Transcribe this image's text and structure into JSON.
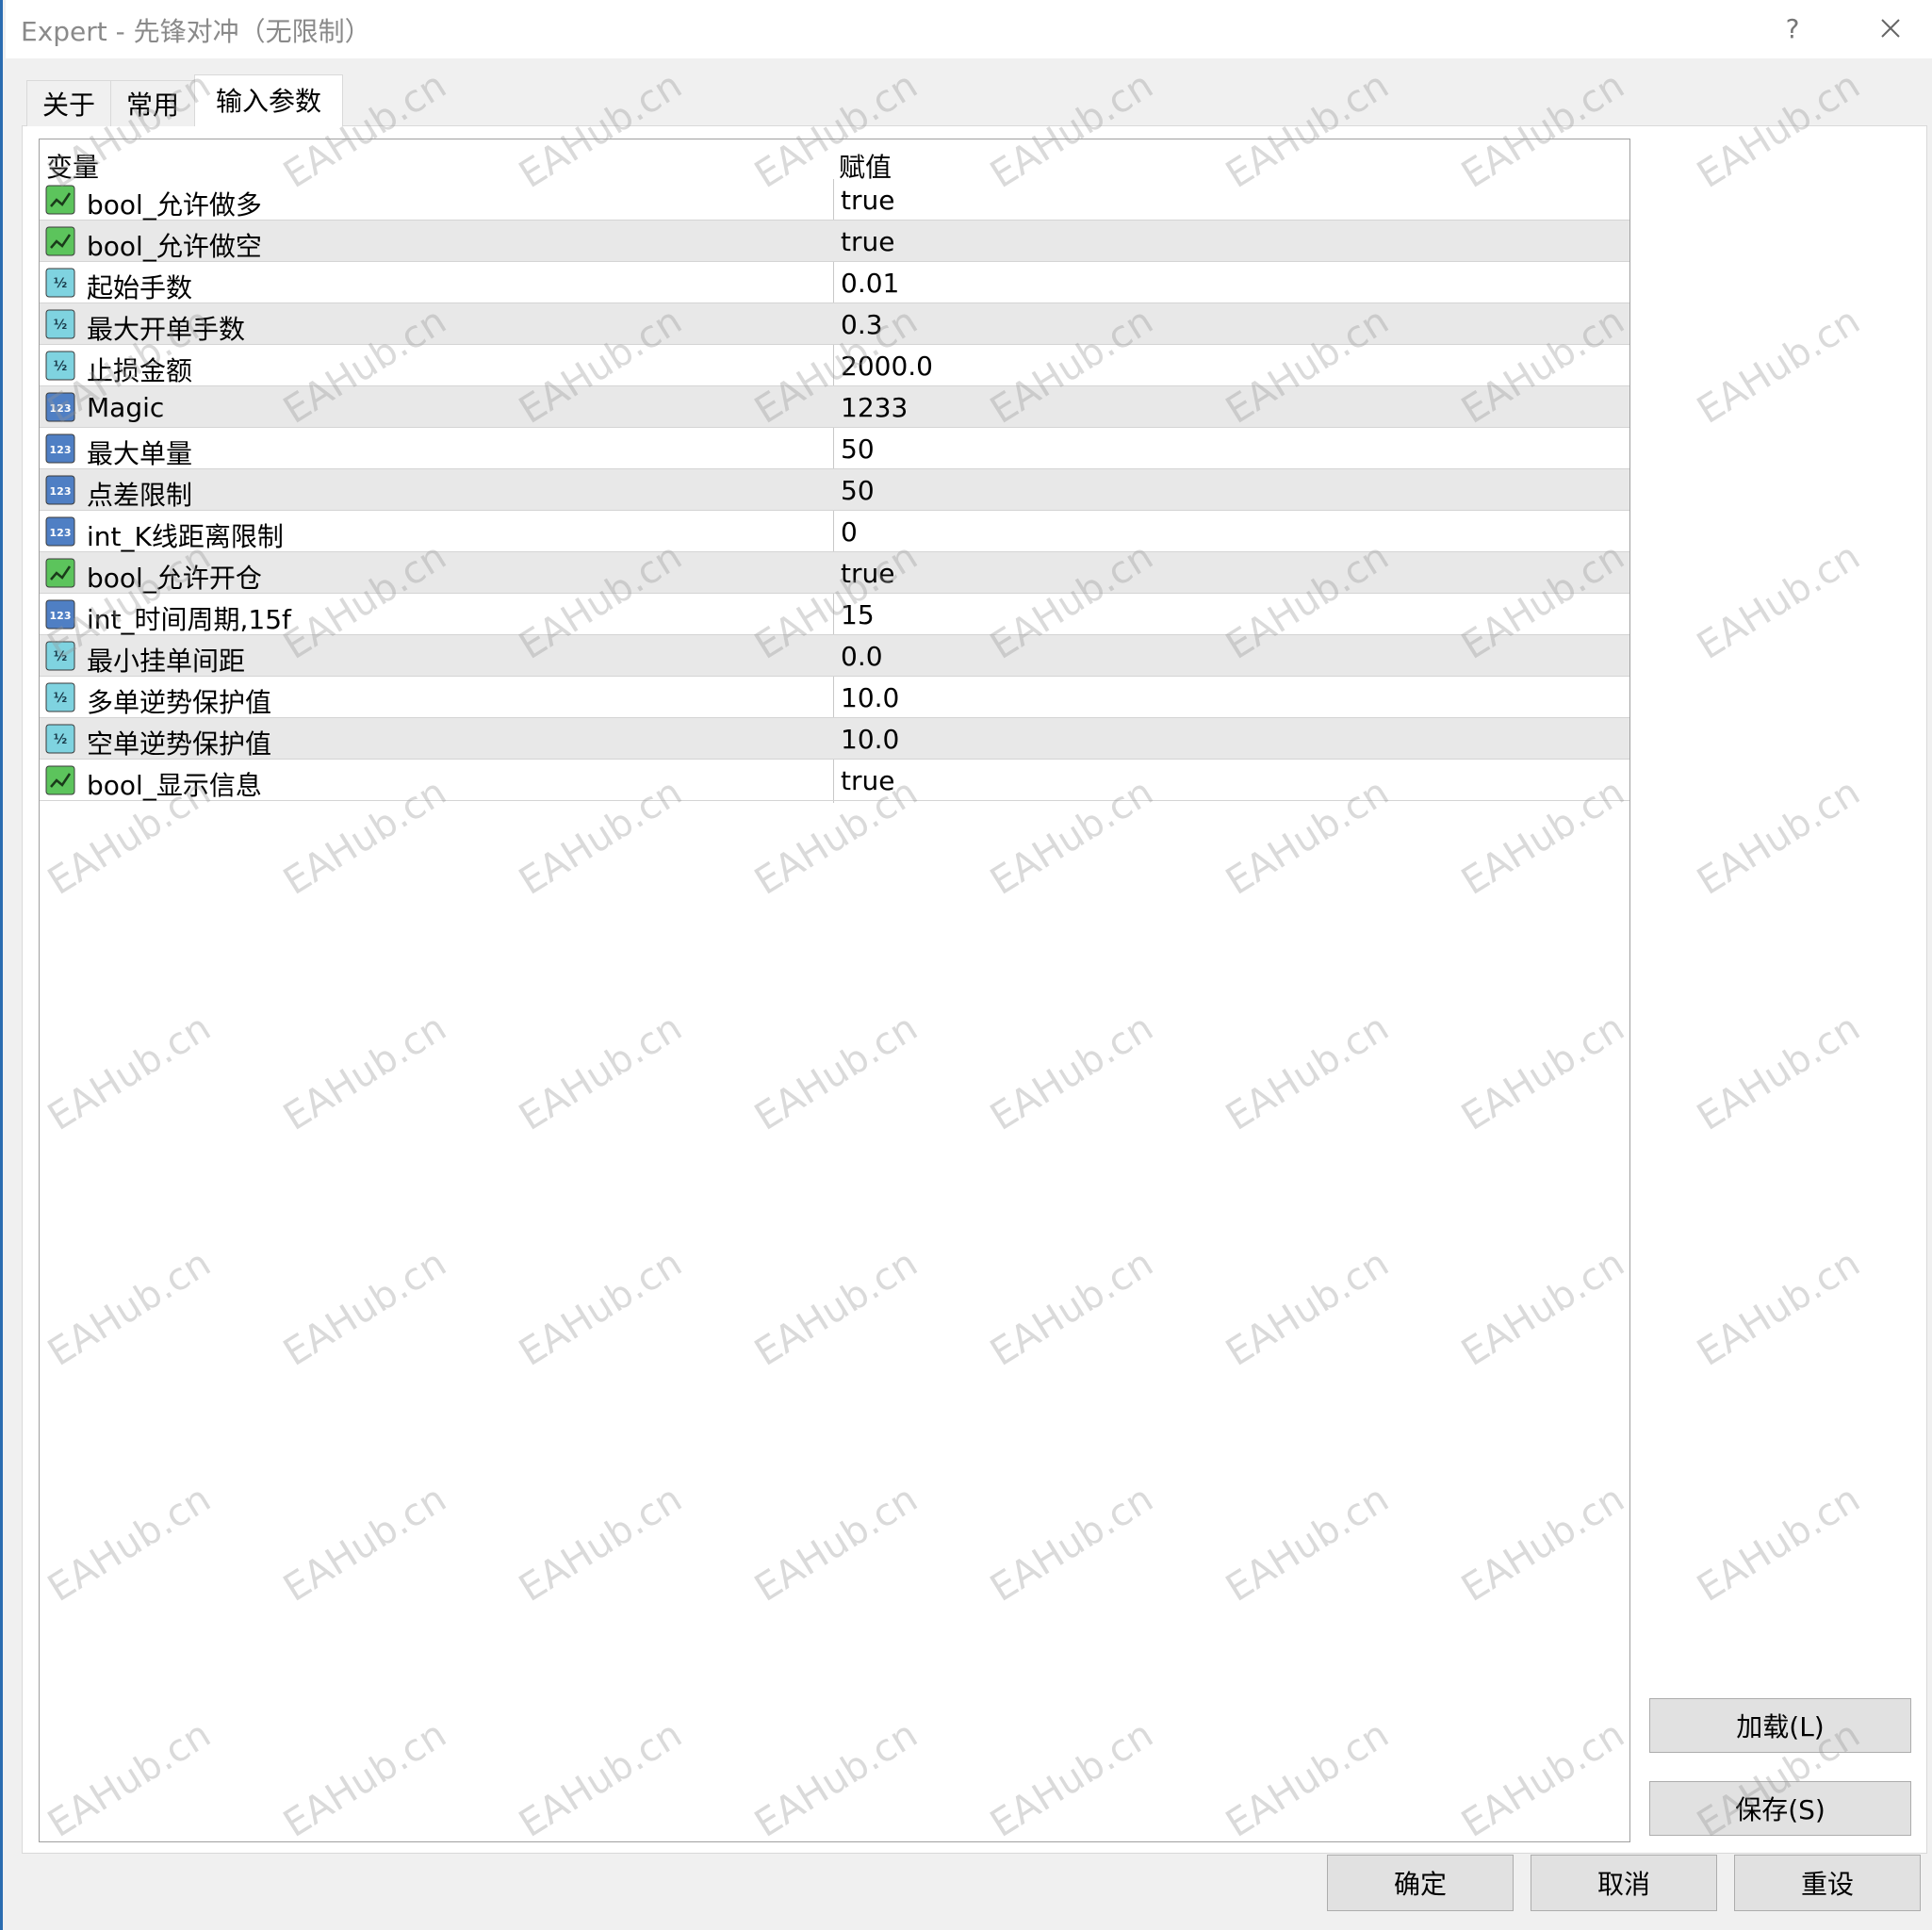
{
  "window": {
    "title": "Expert - 先锋对冲（无限制）",
    "help_label": "?"
  },
  "tabs": [
    {
      "label": "关于",
      "active": false
    },
    {
      "label": "常用",
      "active": false
    },
    {
      "label": "输入参数",
      "active": true
    }
  ],
  "grid": {
    "headers": {
      "variable": "变量",
      "value": "赋值"
    },
    "rows": [
      {
        "name": "bool_允许做多",
        "value": "true",
        "type": "bool-icon"
      },
      {
        "name": "bool_允许做空",
        "value": "true",
        "type": "bool-icon"
      },
      {
        "name": "起始手数",
        "value": "0.01",
        "type": "double-icon"
      },
      {
        "name": "最大开单手数",
        "value": "0.3",
        "type": "double-icon"
      },
      {
        "name": "止损金额",
        "value": "2000.0",
        "type": "double-icon"
      },
      {
        "name": "Magic",
        "value": "1233",
        "type": "int-icon"
      },
      {
        "name": "最大单量",
        "value": "50",
        "type": "int-icon"
      },
      {
        "name": "点差限制",
        "value": "50",
        "type": "int-icon"
      },
      {
        "name": "int_K线距离限制",
        "value": "0",
        "type": "int-icon"
      },
      {
        "name": "bool_允许开仓",
        "value": "true",
        "type": "bool-icon"
      },
      {
        "name": "int_时间周期,15f",
        "value": "15",
        "type": "int-icon"
      },
      {
        "name": "最小挂单间距",
        "value": "0.0",
        "type": "double-icon"
      },
      {
        "name": "多单逆势保护值",
        "value": "10.0",
        "type": "double-icon"
      },
      {
        "name": "空单逆势保护值",
        "value": "10.0",
        "type": "double-icon"
      },
      {
        "name": "bool_显示信息",
        "value": "true",
        "type": "bool-icon"
      }
    ]
  },
  "buttons": {
    "load": "加载(L)",
    "save": "保存(S)",
    "ok": "确定",
    "cancel": "取消",
    "reset": "重设"
  },
  "icon_labels": {
    "int": "123",
    "double": "½"
  },
  "watermark": "EAHub.cn",
  "colors": {
    "bool_icon": "#5cc45c",
    "double_icon": "#7fd3e0",
    "int_icon": "#4f7fc4",
    "row_alt": "#e8e8e8"
  }
}
